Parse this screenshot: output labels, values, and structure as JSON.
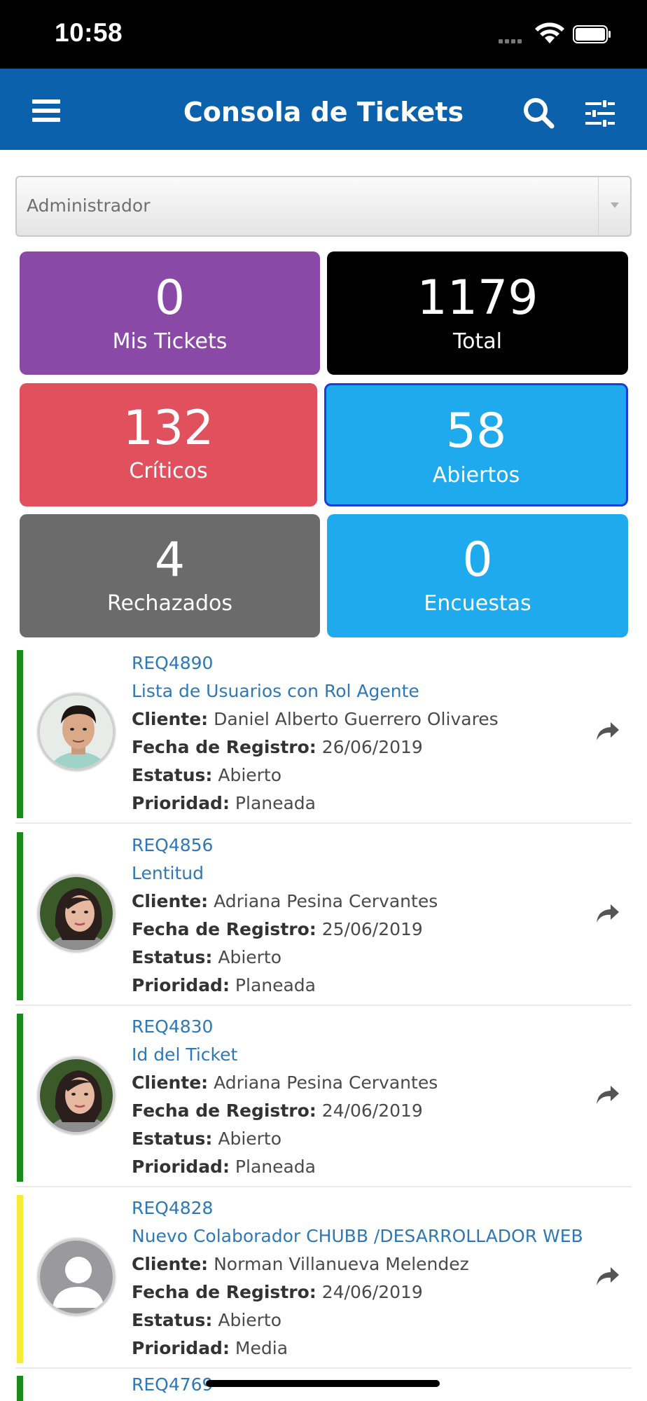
{
  "status_bar": {
    "time": "10:58"
  },
  "header": {
    "title": "Consola de Tickets"
  },
  "role_select": {
    "value": "Administrador"
  },
  "tiles": [
    {
      "value": "0",
      "label": "Mis Tickets",
      "color": "#8a49a6"
    },
    {
      "value": "1179",
      "label": "Total",
      "color": "#000000"
    },
    {
      "value": "132",
      "label": "Críticos",
      "color": "#e0505d"
    },
    {
      "value": "58",
      "label": "Abiertos",
      "color": "#1eaaec"
    },
    {
      "value": "4",
      "label": "Rechazados",
      "color": "#6b6b6b"
    },
    {
      "value": "0",
      "label": "Encuestas",
      "color": "#1eaaec"
    }
  ],
  "labels": {
    "cliente": "Cliente:",
    "fecha": "Fecha de Registro:",
    "estatus": "Estatus:",
    "prioridad": "Prioridad:"
  },
  "tickets": [
    {
      "id": "REQ4890",
      "subject": "Lista de Usuarios con Rol Agente",
      "cliente": "Daniel Alberto Guerrero Olivares",
      "fecha": "26/06/2019",
      "estatus": "Abierto",
      "prioridad": "Planeada",
      "priority_color": "#1a8a1a",
      "avatar": "man-photo"
    },
    {
      "id": "REQ4856",
      "subject": "Lentitud",
      "cliente": "Adriana Pesina Cervantes",
      "fecha": "25/06/2019",
      "estatus": "Abierto",
      "prioridad": "Planeada",
      "priority_color": "#1a8a1a",
      "avatar": "woman-photo"
    },
    {
      "id": "REQ4830",
      "subject": "Id del Ticket",
      "cliente": "Adriana Pesina Cervantes",
      "fecha": "24/06/2019",
      "estatus": "Abierto",
      "prioridad": "Planeada",
      "priority_color": "#1a8a1a",
      "avatar": "woman-photo"
    },
    {
      "id": "REQ4828",
      "subject": "Nuevo Colaborador CHUBB /DESARROLLADOR WEB",
      "cliente": "Norman Villanueva Melendez",
      "fecha": "24/06/2019",
      "estatus": "Abierto",
      "prioridad": "Media",
      "priority_color": "#f5ec3a",
      "avatar": "default-user"
    },
    {
      "id": "REQ4769",
      "priority_color": "#1a8a1a"
    }
  ]
}
